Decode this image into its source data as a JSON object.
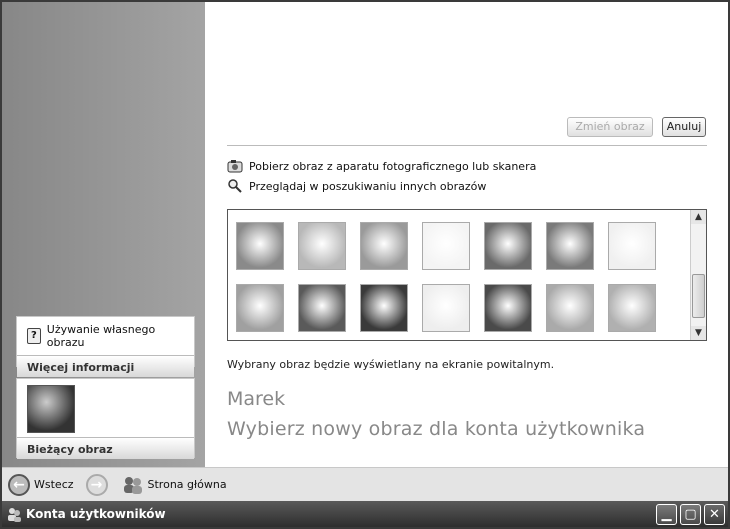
{
  "window": {
    "title": "Konta użytkowników"
  },
  "titlebar": {
    "minimize": "▁",
    "maximize": "▢",
    "close": "✕"
  },
  "nav": {
    "back_label": "Wstecz",
    "forward_label": "",
    "home_label": "Strona główna"
  },
  "sidebar": {
    "current_picture": {
      "header": "Bieżący obraz"
    },
    "more_info": {
      "header": "Więcej informacji",
      "items": [
        {
          "label": "Używanie własnego obrazu"
        }
      ]
    }
  },
  "main": {
    "heading": "Wybierz nowy obraz dla konta użytkownika",
    "username": "Marek",
    "note": "Wybrany obraz będzie wyświetlany na ekranie powitalnym.",
    "links": [
      {
        "label": "Przeglądaj w poszukiwaniu innych obrazów",
        "icon": "magnifier-icon"
      },
      {
        "label": "Pobierz obraz z aparatu fotograficznego lub skanera",
        "icon": "camera-icon"
      }
    ],
    "buttons": {
      "change": "Zmień obraz",
      "cancel": "Anuluj"
    },
    "pictures": [
      {
        "name": "picture-guitar",
        "color": "#8a8a8a"
      },
      {
        "name": "picture-snowflake",
        "color": "#b8b8b8"
      },
      {
        "name": "picture-beach-chair",
        "color": "#9a9a9a"
      },
      {
        "name": "picture-skateboard",
        "color": "#f4f4f4"
      },
      {
        "name": "picture-chess",
        "color": "#6a6a6a"
      },
      {
        "name": "picture-dirt-bike",
        "color": "#7a7a7a"
      },
      {
        "name": "picture-ducks",
        "color": "#f0f0f0"
      },
      {
        "name": "picture-airplane",
        "color": "#a0a0a0"
      },
      {
        "name": "picture-astronaut",
        "color": "#5a5a5a"
      },
      {
        "name": "picture-soccer-ball",
        "color": "#3a3a3a"
      },
      {
        "name": "picture-butterfly",
        "color": "#eeeeee"
      },
      {
        "name": "picture-cat",
        "color": "#4a4a4a"
      },
      {
        "name": "picture-fish",
        "color": "#aaaaaa"
      },
      {
        "name": "picture-flower",
        "color": "#b0b0b0"
      }
    ]
  }
}
